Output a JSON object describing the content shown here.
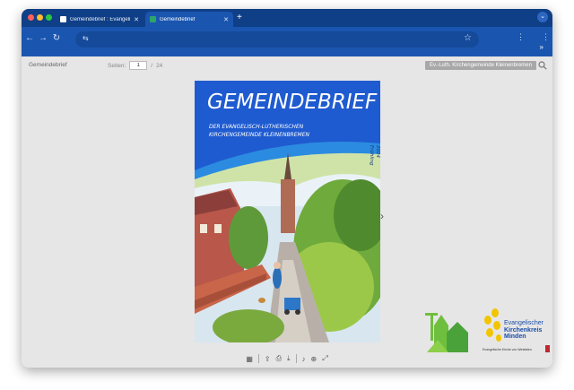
{
  "browser": {
    "tabs": [
      {
        "label": "Gemeindebrief : Evangelische…",
        "active": false
      },
      {
        "label": "Gemeindebrief",
        "active": true
      }
    ],
    "new_tab": "+",
    "menu_chevron": "⌄",
    "bookmarks_more": "»"
  },
  "viewer": {
    "title": "Gemeindebrief",
    "pages_label": "Seiten:",
    "current_page": "1",
    "separator": "/",
    "total_pages": "24",
    "publisher": "Ev.-Luth. Kirchengemeinde Kleinenbremen"
  },
  "cover": {
    "title": "GEMEINDEBRIEF",
    "subtitle_line1": "DER EVANGELISCH-LUTHERISCHEN",
    "subtitle_line2": "KIRCHENGEMEINDE KLEINENBREMEN",
    "season_line1": "Frühling",
    "season_line2": "2024"
  },
  "logos": {
    "kk_line1": "Evangelischer",
    "kk_line2": "Kirchenkreis",
    "kk_line3": "Minden",
    "kk_sub": "Evangelische Kirche von Westfalen"
  },
  "colors": {
    "tab_bar": "#0f3f86",
    "toolbar": "#1a56b0",
    "cover_blue": "#1f5bd0",
    "viewer_bg": "#e6e6e6"
  }
}
